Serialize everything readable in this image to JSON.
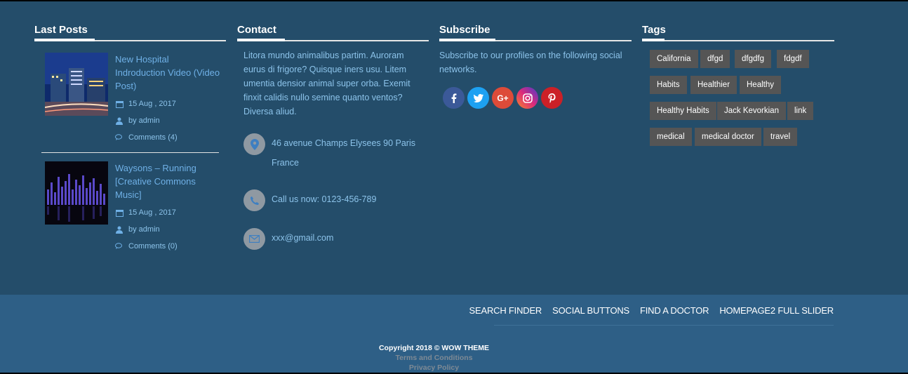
{
  "last_posts": {
    "title": "Last Posts",
    "posts": [
      {
        "title": "New Hospital Indroduction Video (Video Post)",
        "date": "15 Aug , 2017",
        "author": "by admin",
        "comments": "Comments (4)"
      },
      {
        "title": "Waysons – Running [Creative Commons Music]",
        "date": "15 Aug , 2017",
        "author": "by admin",
        "comments": "Comments (0)"
      }
    ]
  },
  "contact": {
    "title": "Contact",
    "text": "Litora mundo animalibus partim. Auroram eurus di frigore? Quisque iners usu. Litem umentia densior animal super orba. Exemit finxit calidis nullo semine quanto ventos? Diversa aliud.",
    "address_line1": "46 avenue Champs Elysees 90 Paris",
    "address_line2": "France",
    "phone": "Call us now: 0123-456-789",
    "email": "xxx@gmail.com"
  },
  "subscribe": {
    "title": "Subscribe",
    "text": "Subscribe to our profiles on the following social networks.",
    "networks": [
      {
        "icon": "facebook-icon",
        "glyph": "f",
        "color": "#3b5998"
      },
      {
        "icon": "twitter-icon",
        "glyph": "t",
        "color": "#1da1f2"
      },
      {
        "icon": "google-plus-icon",
        "glyph": "G+",
        "color": "#dd4b39"
      },
      {
        "icon": "instagram-icon",
        "glyph": "◎",
        "color": "#8a3ab9"
      },
      {
        "icon": "pinterest-icon",
        "glyph": "P",
        "color": "#cb2027"
      }
    ]
  },
  "tags": {
    "title": "Tags",
    "items": [
      "California",
      "dfgd",
      "dfgdfg",
      "fdgdf",
      "Habits",
      "Healthier",
      "Healthy",
      "Healthy Habits",
      "Jack Kevorkian",
      "link",
      "medical",
      "medical doctor",
      "travel"
    ]
  },
  "footer": {
    "menu": [
      "SEARCH FINDER",
      "SOCIAL BUTTONS",
      "FIND A DOCTOR",
      "HOMEPAGE2 FULL SLIDER"
    ],
    "copyright": "Copyright 2018 © WOW THEME",
    "terms": "Terms and Conditions",
    "privacy": "Privacy Policy"
  }
}
